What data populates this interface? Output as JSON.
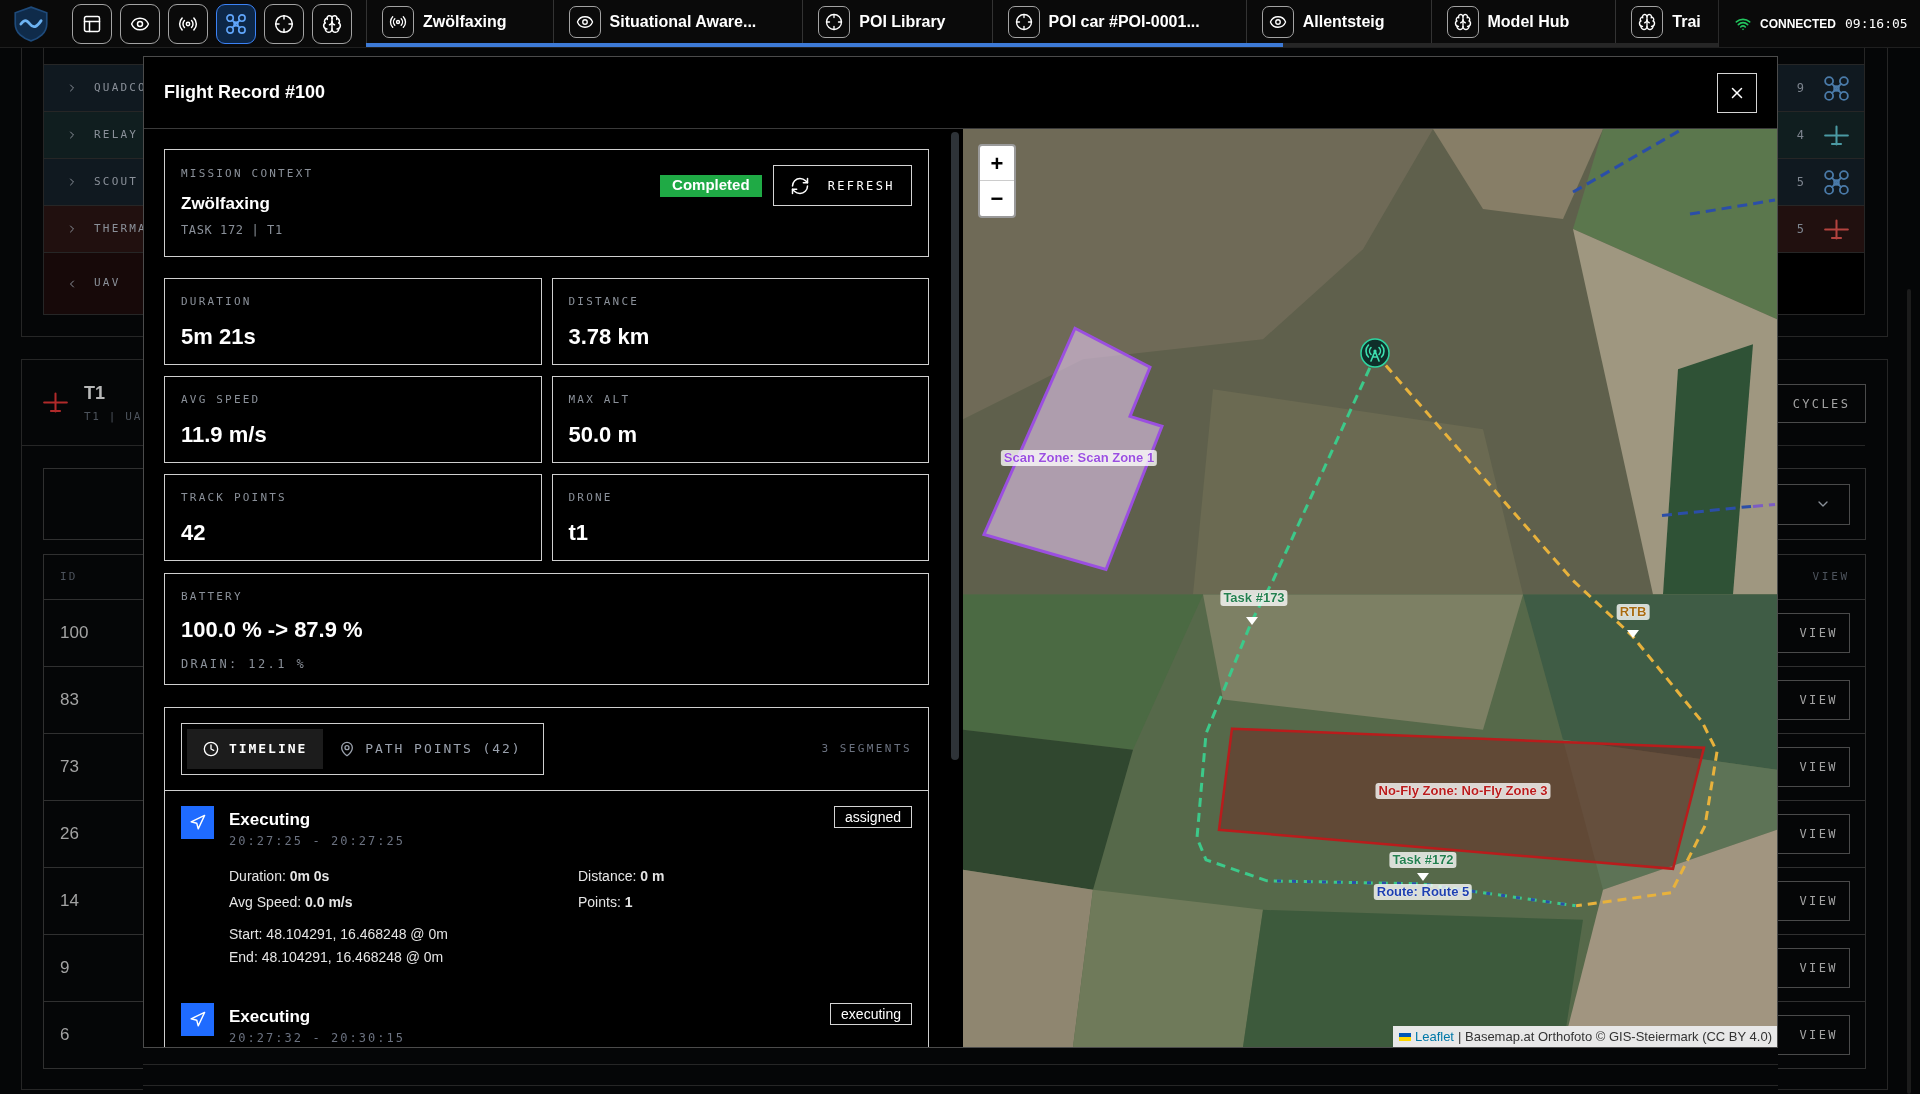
{
  "top_bar": {
    "tool_buttons": [
      {
        "kind": "layout",
        "selected": false
      },
      {
        "kind": "view",
        "selected": false
      },
      {
        "kind": "broadcast",
        "selected": false
      },
      {
        "kind": "drone",
        "selected": true
      },
      {
        "kind": "target",
        "selected": false
      },
      {
        "kind": "model",
        "selected": false
      }
    ],
    "tabs": [
      {
        "label": "Zwölfaxing",
        "kind": "broadcast"
      },
      {
        "label": "Situational Aware...",
        "kind": "view"
      },
      {
        "label": "POI Library",
        "kind": "target"
      },
      {
        "label": "POI car #POI-0001...",
        "kind": "target"
      },
      {
        "label": "Allentsteig",
        "kind": "view"
      },
      {
        "label": "Model Hub",
        "kind": "model"
      },
      {
        "label": "Trai",
        "kind": "model"
      }
    ],
    "connection": {
      "status": "CONNECTED",
      "time": "09:16:05"
    }
  },
  "background": {
    "categories": [
      {
        "label": "QUADCO",
        "count": "9",
        "kind": "quad",
        "color": "#4a7aa8"
      },
      {
        "label": "RELAY",
        "count": "4",
        "kind": "plane",
        "color": "#4b9aa3"
      },
      {
        "label": "SCOUT",
        "count": "5",
        "kind": "quad",
        "color": "#4a7aa8"
      },
      {
        "label": "THERMA",
        "count": "5",
        "kind": "plane",
        "color": "#b3433f"
      },
      {
        "label": "UAV",
        "kind": "group"
      }
    ],
    "drone": {
      "name": "T1",
      "subtitle": "T1 | UA"
    },
    "cycles_button": "CYCLES",
    "table": {
      "columns": [
        "ID",
        "VIEW"
      ],
      "rows": [
        {
          "id": "100",
          "action": "VIEW"
        },
        {
          "id": "83",
          "action": "VIEW"
        },
        {
          "id": "73",
          "action": "VIEW"
        },
        {
          "id": "26",
          "action": "VIEW"
        },
        {
          "id": "14",
          "action": "VIEW"
        },
        {
          "id": "9",
          "action": "VIEW"
        },
        {
          "id": "6",
          "action": "VIEW"
        }
      ]
    }
  },
  "flight_record": {
    "title": "Flight Record #100",
    "mission": {
      "label": "MISSION CONTEXT",
      "name": "Zwölfaxing",
      "meta": "TASK 172 | T1",
      "status": {
        "label": "Completed",
        "kind": "success"
      },
      "refresh": "REFRESH"
    },
    "stats": [
      {
        "label": "DURATION",
        "value": "5m 21s"
      },
      {
        "label": "DISTANCE",
        "value": "3.78 km"
      },
      {
        "label": "AVG SPEED",
        "value": "11.9 m/s"
      },
      {
        "label": "MAX ALT",
        "value": "50.0 m"
      },
      {
        "label": "TRACK POINTS",
        "value": "42"
      },
      {
        "label": "DRONE",
        "value": "t1"
      }
    ],
    "battery": {
      "label": "BATTERY",
      "value": "100.0 % -> 87.9 %",
      "drain": "DRAIN: 12.1 %"
    },
    "view_tabs": [
      {
        "label": "TIMELINE",
        "kind": "clock",
        "selected": true
      },
      {
        "label": "PATH POINTS (42)",
        "kind": "pin",
        "selected": false
      }
    ],
    "segment_count": "3 SEGMENTS",
    "segments": [
      {
        "title": "Executing",
        "time": "20:27:25 - 20:27:25",
        "status": "assigned",
        "details": [
          "Duration: **0m 0s**",
          "Distance: **0 m**",
          "Avg Speed: **0.0 m/s**",
          "Points: **1**"
        ],
        "coords": [
          "Start: 48.104291, 16.468248 @ 0m",
          "End: 48.104291, 16.468248 @ 0m"
        ]
      },
      {
        "title": "Executing",
        "time": "20:27:32 - 20:30:15",
        "status": "executing"
      }
    ]
  },
  "map": {
    "zoom_in": "+",
    "zoom_out": "−",
    "zones": [
      {
        "kind": "scan",
        "label": "Scan Zone: Scan Zone 1",
        "color": "#9b4fe0"
      },
      {
        "kind": "no_fly",
        "label": "No-Fly Zone: No-Fly Zone 3",
        "color": "#b91c1c"
      }
    ],
    "waypoints": [
      {
        "label": "Task #173",
        "color": "#237f4f"
      },
      {
        "label": "RTB",
        "color": "#a86b12"
      },
      {
        "label": "Task #172",
        "color": "#237f4f"
      }
    ],
    "route": {
      "label": "Route: Route 5",
      "color": "#1e40af"
    },
    "attribution": {
      "link": "Leaflet",
      "text": "| Basemap.at Orthofoto © GIS-Steiermark (CC BY 4.0)"
    }
  }
}
